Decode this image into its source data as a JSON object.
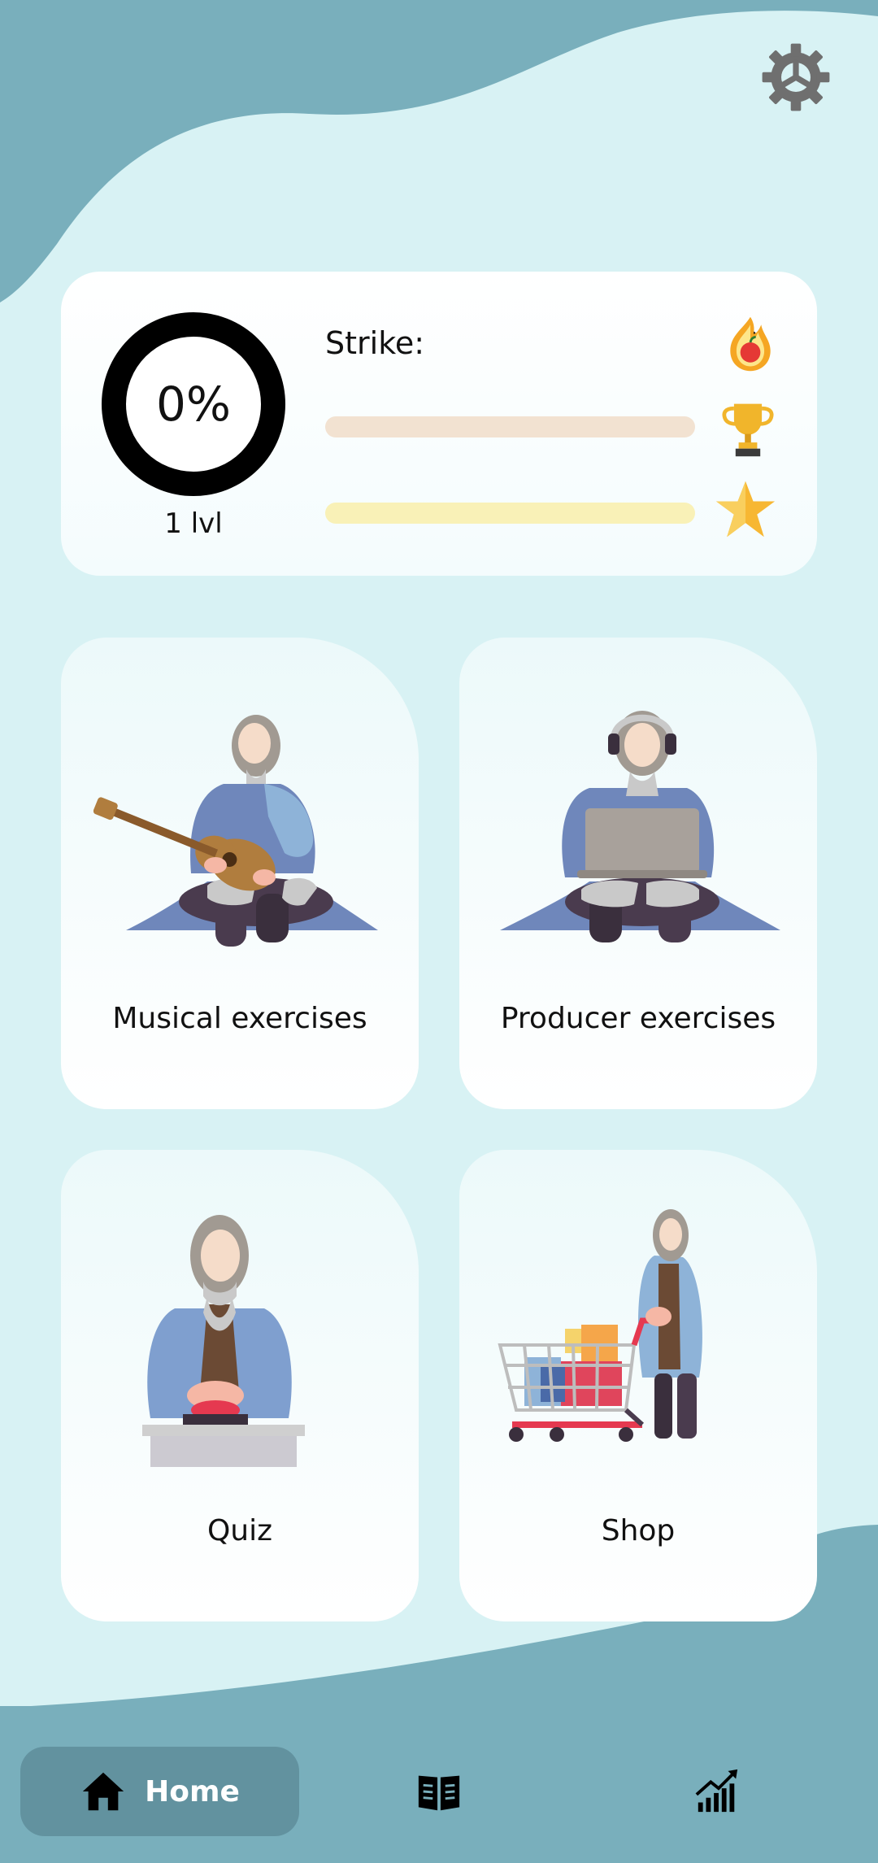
{
  "stats": {
    "progress_text": "0%",
    "progress_value": 0,
    "level_text": "1 lvl",
    "strike_label": "Strike:",
    "strike_value": "0",
    "bar1_fill": 0,
    "bar2_fill": 0,
    "icons": [
      "fire-apple-icon",
      "trophy-icon",
      "star-icon"
    ]
  },
  "tiles": [
    {
      "label": "Musical exercises",
      "art": "guitarist-illustration"
    },
    {
      "label": "Producer exercises",
      "art": "producer-laptop-illustration"
    },
    {
      "label": "Quiz",
      "art": "quiz-buzzer-illustration"
    },
    {
      "label": "Shop",
      "art": "shopping-cart-illustration"
    }
  ],
  "nav": {
    "home_label": "Home",
    "items": [
      "home-icon",
      "book-icon",
      "stats-icon"
    ]
  },
  "colors": {
    "background": "#d8f2f4",
    "wave": "#79afbc",
    "nav_active": "#62929f"
  }
}
